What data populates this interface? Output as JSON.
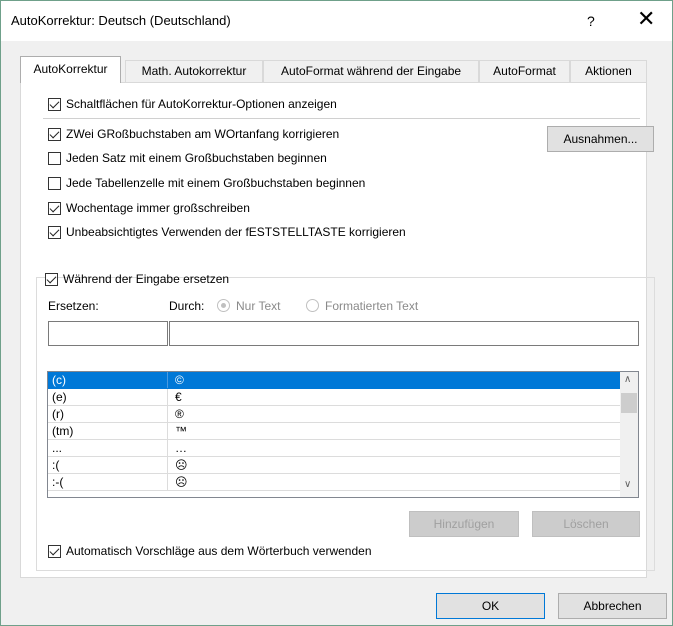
{
  "window": {
    "title": "AutoKorrektur: Deutsch (Deutschland)",
    "help_label": "?",
    "close_label": "✕"
  },
  "tabs": [
    {
      "label": "AutoKorrektur",
      "active": true
    },
    {
      "label": "Math. Autokorrektur",
      "active": false
    },
    {
      "label": "AutoFormat während der Eingabe",
      "active": false
    },
    {
      "label": "AutoFormat",
      "active": false
    },
    {
      "label": "Aktionen",
      "active": false
    }
  ],
  "options": {
    "show_buttons": {
      "label": "Schaltflächen für AutoKorrektur-Optionen anzeigen",
      "checked": true
    },
    "two_caps": {
      "label": "ZWei GRoßbuchstaben am WOrtanfang korrigieren",
      "checked": true
    },
    "sentence_cap": {
      "label": "Jeden Satz mit einem Großbuchstaben beginnen",
      "checked": false
    },
    "table_cell_cap": {
      "label": "Jede Tabellenzelle mit einem Großbuchstaben beginnen",
      "checked": false
    },
    "weekdays": {
      "label": "Wochentage immer großschreiben",
      "checked": true
    },
    "capslock": {
      "label": "Unbeabsichtigtes Verwenden der fESTSTELLTASTE korrigieren",
      "checked": true
    }
  },
  "exceptions_button": "Ausnahmen...",
  "replace_group": {
    "label": "Während der Eingabe ersetzen",
    "checked": true,
    "replace_label": "Ersetzen:",
    "with_label": "Durch:",
    "radio_plain": "Nur Text",
    "radio_formatted": "Formatierten Text",
    "replace_value": "",
    "with_value": ""
  },
  "replacements": [
    {
      "from": "(c)",
      "to": "©",
      "selected": true
    },
    {
      "from": "(e)",
      "to": "€",
      "selected": false
    },
    {
      "from": "(r)",
      "to": "®",
      "selected": false
    },
    {
      "from": "(tm)",
      "to": "™",
      "selected": false
    },
    {
      "from": "...",
      "to": "…",
      "selected": false
    },
    {
      "from": ":(",
      "to": "☹",
      "selected": false
    },
    {
      "from": ":-(",
      "to": "☹",
      "selected": false
    }
  ],
  "scroll_up_label": "∧",
  "scroll_down_label": "∨",
  "add_button": "Hinzufügen",
  "delete_button": "Löschen",
  "dictionary_suggestions": {
    "label": "Automatisch Vorschläge aus dem Wörterbuch verwenden",
    "checked": true
  },
  "ok_button": "OK",
  "cancel_button": "Abbrechen"
}
